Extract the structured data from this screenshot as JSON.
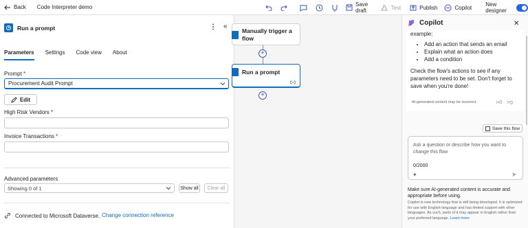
{
  "topbar": {
    "back_label": "Back",
    "title": "Code Interpreter demo",
    "save_draft": "Save draft",
    "test": "Test",
    "publish": "Publish",
    "copilot": "Copilot",
    "new_designer": "New designer"
  },
  "panel": {
    "title": "Run a prompt",
    "tabs": [
      "Parameters",
      "Settings",
      "Code view",
      "About"
    ],
    "prompt_label": "Prompt",
    "prompt_value": "Procurement Audit Prompt",
    "edit_label": "Edit",
    "high_risk_label": "High Risk Vendors",
    "invoice_label": "Invoice Transactions",
    "advanced_label": "Advanced parameters",
    "advanced_value": "Showing 0 of 1",
    "show_all": "Show all",
    "clear_all": "Clear all",
    "connection_text": "Connected to Microsoft Dataverse.",
    "change_connection": "Change connection reference"
  },
  "canvas": {
    "trigger_title": "Manually trigger a flow",
    "action_title": "Run a prompt"
  },
  "copilot": {
    "title": "Copilot",
    "intro": "example:",
    "bullets": [
      "Add an action that sends an email",
      "Explain what an action does",
      "Add a condition"
    ],
    "tail": "Check the flow's actions to see if any parameters need to be set. Don't forget to save when you're done!",
    "ai_note": "AI-generated content may be incorrect",
    "save_flow": "Save this flow",
    "input_placeholder": "Ask a question or describe how you want to change this flow",
    "count": "0/2000",
    "footer": "Make sure AI-generated content is accurate and appropriate before using.",
    "disclaimer": "Copilot is new technology that is still being developed. It is optimized for use with English language and has limited support with other languages. As such, parts of it may appear in English rather than your preferred language.",
    "learn_more": "Learn more"
  },
  "colors": {
    "accent": "#0f6cbd",
    "toggle": "#2266e3",
    "required": "#c50f1f"
  }
}
